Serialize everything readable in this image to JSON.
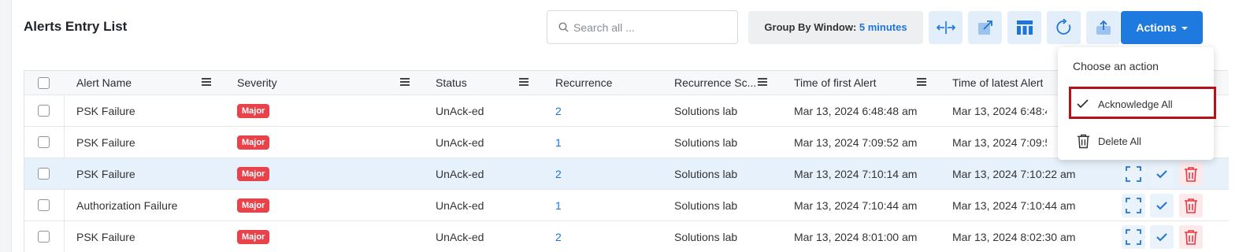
{
  "page": {
    "title": "Alerts Entry List"
  },
  "search": {
    "placeholder": "Search all ..."
  },
  "groupby": {
    "label": "Group By Window:",
    "value": "5 minutes"
  },
  "toolbar": {
    "buttons": [
      "split-columns-icon",
      "open-external-icon",
      "layout-icon",
      "refresh-icon",
      "export-icon"
    ],
    "actions_label": "Actions"
  },
  "table": {
    "headers": [
      "Alert Name",
      "Severity",
      "Status",
      "Recurrence",
      "Recurrence Sc...",
      "Time of first Alert",
      "Time of latest Alert"
    ],
    "rows": [
      {
        "name": "PSK Failure",
        "severity": "Major",
        "status": "UnAck-ed",
        "recurrence": "2",
        "scope": "Solutions lab",
        "first": "Mar 13, 2024 6:48:48 am",
        "latest": "Mar 13, 2024 6:48:4"
      },
      {
        "name": "PSK Failure",
        "severity": "Major",
        "status": "UnAck-ed",
        "recurrence": "1",
        "scope": "Solutions lab",
        "first": "Mar 13, 2024 7:09:52 am",
        "latest": "Mar 13, 2024 7:09:5"
      },
      {
        "name": "PSK Failure",
        "severity": "Major",
        "status": "UnAck-ed",
        "recurrence": "2",
        "scope": "Solutions lab",
        "first": "Mar 13, 2024 7:10:14 am",
        "latest": "Mar 13, 2024 7:10:22 am"
      },
      {
        "name": "Authorization Failure",
        "severity": "Major",
        "status": "UnAck-ed",
        "recurrence": "1",
        "scope": "Solutions lab",
        "first": "Mar 13, 2024 7:10:44 am",
        "latest": "Mar 13, 2024 7:10:44 am"
      },
      {
        "name": "PSK Failure",
        "severity": "Major",
        "status": "UnAck-ed",
        "recurrence": "2",
        "scope": "Solutions lab",
        "first": "Mar 13, 2024 8:01:00 am",
        "latest": "Mar 13, 2024 8:02:30 am"
      }
    ],
    "selected_row": 3
  },
  "dropdown": {
    "header": "Choose an action",
    "items": [
      {
        "label": "Acknowledge All",
        "icon": "check-icon"
      },
      {
        "label": "Delete All",
        "icon": "trash-icon"
      }
    ],
    "highlighted": "Acknowledge All"
  },
  "colors": {
    "accent": "#1f7ae0",
    "badge": "#e8424a",
    "highlight_box": "#b31218",
    "selected_row": "#e6f1fb"
  }
}
